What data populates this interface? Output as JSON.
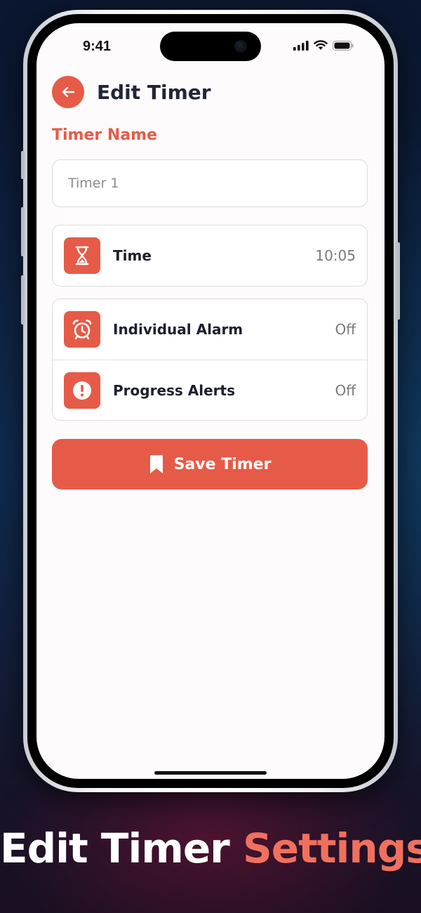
{
  "status_bar": {
    "time": "9:41"
  },
  "header": {
    "title": "Edit Timer"
  },
  "form": {
    "name_label": "Timer Name",
    "name_value": "Timer 1",
    "name_placeholder": "Timer 1"
  },
  "time_row": {
    "label": "Time",
    "value": "10:05",
    "icon": "hourglass-icon"
  },
  "settings": [
    {
      "label": "Individual Alarm",
      "value": "Off",
      "icon": "alarm-clock-icon"
    },
    {
      "label": "Progress Alerts",
      "value": "Off",
      "icon": "exclamation-icon"
    }
  ],
  "save_button": {
    "label": "Save Timer",
    "icon": "bookmark-icon"
  },
  "caption": {
    "part1": "Edit Timer",
    "part2": "Settings"
  },
  "colors": {
    "accent": "#e55b48",
    "title": "#22263a",
    "caption_accent": "#f0705e"
  }
}
